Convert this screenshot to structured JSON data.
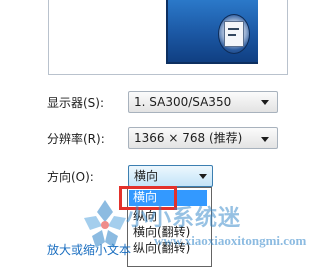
{
  "settings": {
    "display": {
      "label": "显示器(S):",
      "value": "1. SA300/SA350"
    },
    "resolution": {
      "label": "分辨率(R):",
      "value": "1366 × 768 (推荐)"
    },
    "orientation": {
      "label": "方向(O):",
      "value": "横向",
      "options": [
        "横向",
        "纵向",
        "横向(翻转)",
        "纵向(翻转)"
      ]
    }
  },
  "link": {
    "text": "放大或缩小文本"
  },
  "watermark": {
    "text": "小小系统迷",
    "url": "www.xiaoxiaoxitongmi.com"
  },
  "colors": {
    "selection": "#3399ff",
    "annotation": "#e3312b",
    "link": "#1a6ec0",
    "watermark": "#2f84c9"
  }
}
